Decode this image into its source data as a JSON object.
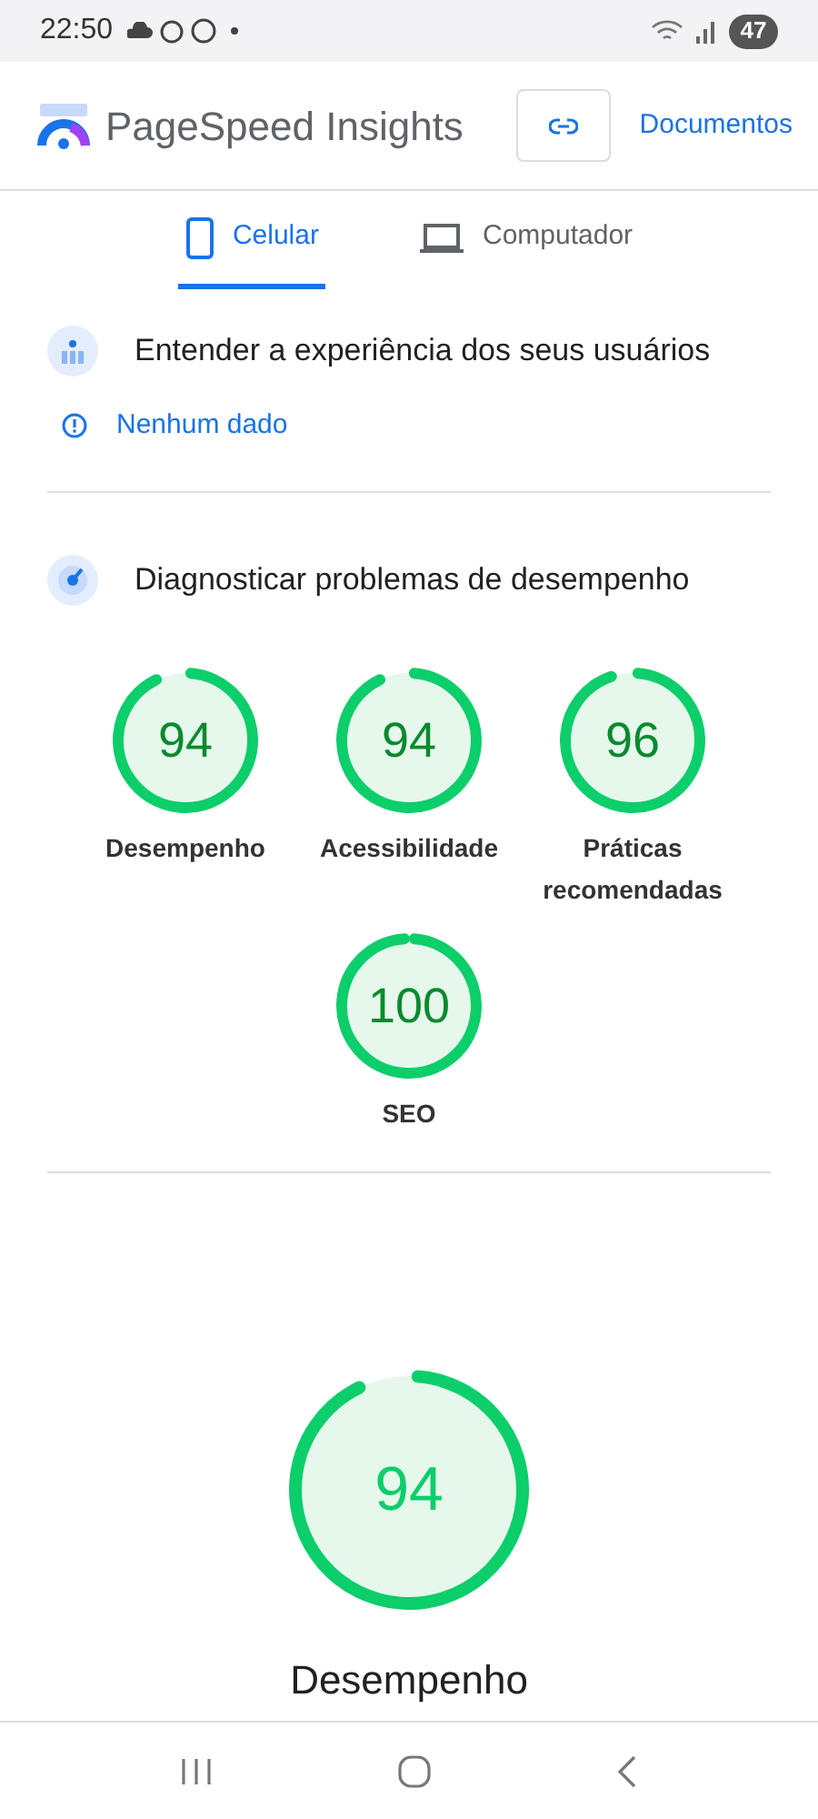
{
  "status_bar": {
    "time": "22:50",
    "battery": "47"
  },
  "header": {
    "title": "PageSpeed Insights",
    "docs_link": "Documentos"
  },
  "tabs": [
    {
      "label": "Celular",
      "kind": "phone",
      "selected": true
    },
    {
      "label": "Computador",
      "kind": "desktop",
      "selected": false
    }
  ],
  "field_data": {
    "heading": "Entender a experiência dos seus usuários",
    "message": "Nenhum dado"
  },
  "diagnostics": {
    "heading": "Diagnosticar problemas de desempenho",
    "scores": [
      {
        "value": "94",
        "label": "Desempenho",
        "level": 0.94
      },
      {
        "value": "94",
        "label": "Acessibilidade",
        "level": 0.94
      },
      {
        "value": "96",
        "label": "Práticas recomendadas",
        "level": 0.96
      },
      {
        "value": "100",
        "label": "SEO",
        "level": 1
      }
    ]
  },
  "summary": {
    "value": "94",
    "label": "Desempenho",
    "level": 0.94
  }
}
